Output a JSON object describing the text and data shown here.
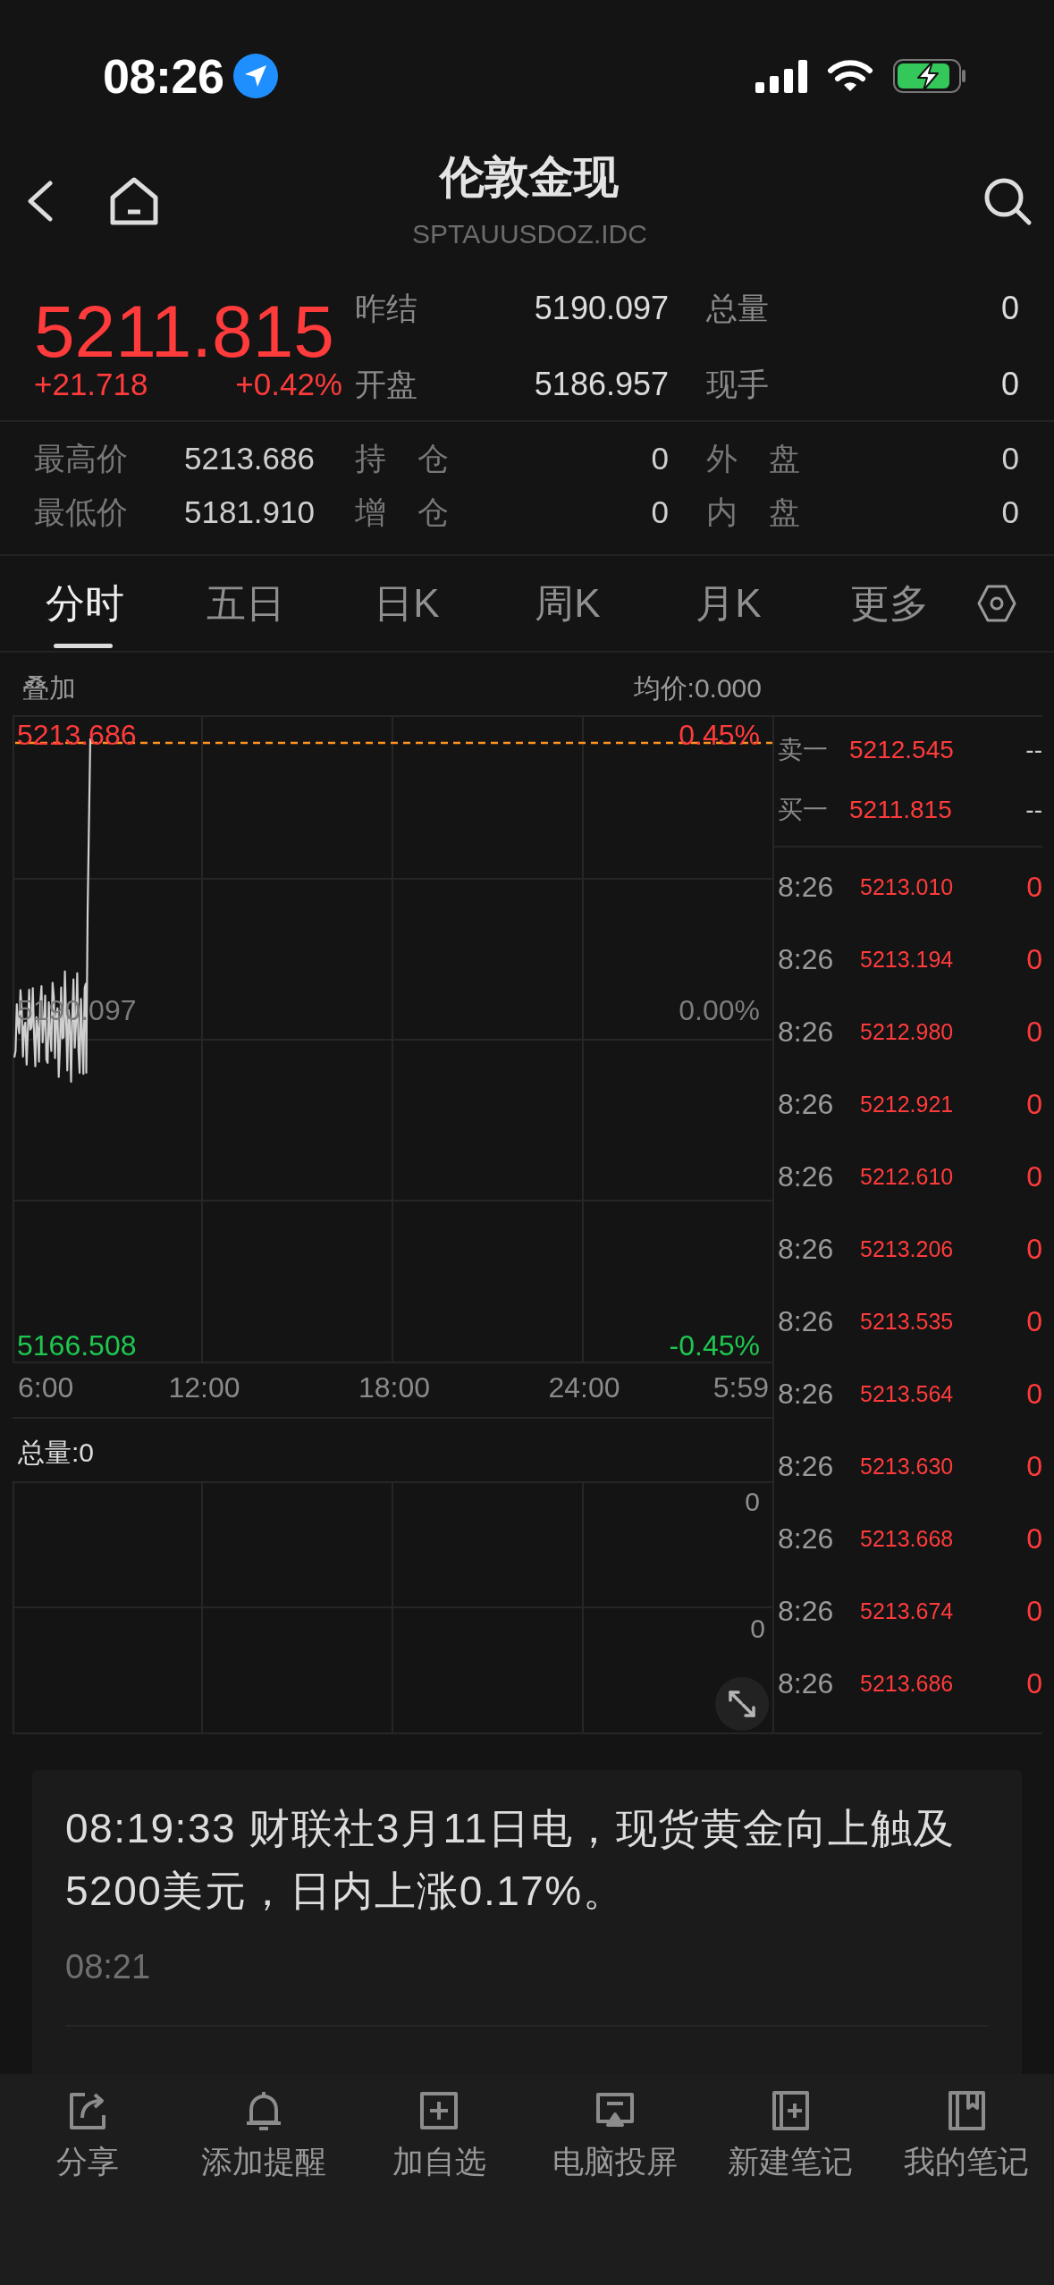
{
  "status_bar": {
    "time": "08:26"
  },
  "header": {
    "title": "伦敦金现",
    "code": "SPTAUUSDOZ.IDC"
  },
  "quote": {
    "price": "5211.815",
    "change": "+21.718",
    "change_pct": "+0.42%",
    "stats": [
      {
        "label": "昨结",
        "value": "5190.097"
      },
      {
        "label": "总量",
        "value": "0"
      },
      {
        "label": "开盘",
        "value": "5186.957"
      },
      {
        "label": "现手",
        "value": "0"
      }
    ]
  },
  "details": [
    {
      "label": "最高价",
      "value": "5213.686"
    },
    {
      "label": "持 仓",
      "value": "0"
    },
    {
      "label": "外 盘",
      "value": "0"
    },
    {
      "label": "最低价",
      "value": "5181.910"
    },
    {
      "label": "增 仓",
      "value": "0"
    },
    {
      "label": "内 盘",
      "value": "0"
    }
  ],
  "tabs": [
    {
      "label": "分时",
      "selected": true
    },
    {
      "label": "五日",
      "selected": false
    },
    {
      "label": "日K",
      "selected": false
    },
    {
      "label": "周K",
      "selected": false
    },
    {
      "label": "月K",
      "selected": false
    },
    {
      "label": "更多",
      "selected": false
    }
  ],
  "chart": {
    "overlay": "叠加",
    "avg_price": "均价:0.000",
    "levels": [
      {
        "price": "5213.686",
        "pct": "0.45%",
        "kind": "up"
      },
      {
        "price": "5190.097",
        "pct": "0.00%",
        "kind": "flat"
      },
      {
        "price": "5166.508",
        "pct": "-0.45%",
        "kind": "down"
      }
    ],
    "times": [
      "6:00",
      "12:00",
      "18:00",
      "24:00",
      "5:59"
    ]
  },
  "volume": {
    "total": "总量:0",
    "labels": [
      "0",
      "0"
    ]
  },
  "order_book": [
    {
      "label": "卖一",
      "price": "5212.545",
      "volume": "--"
    },
    {
      "label": "买一",
      "price": "5211.815",
      "volume": "--"
    }
  ],
  "ticks": [
    {
      "time": "8:26",
      "price": "5213.010",
      "volume": "0"
    },
    {
      "time": "8:26",
      "price": "5213.194",
      "volume": "0"
    },
    {
      "time": "8:26",
      "price": "5212.980",
      "volume": "0"
    },
    {
      "time": "8:26",
      "price": "5212.921",
      "volume": "0"
    },
    {
      "time": "8:26",
      "price": "5212.610",
      "volume": "0"
    },
    {
      "time": "8:26",
      "price": "5213.206",
      "volume": "0"
    },
    {
      "time": "8:26",
      "price": "5213.535",
      "volume": "0"
    },
    {
      "time": "8:26",
      "price": "5213.564",
      "volume": "0"
    },
    {
      "time": "8:26",
      "price": "5213.630",
      "volume": "0"
    },
    {
      "time": "8:26",
      "price": "5213.668",
      "volume": "0"
    },
    {
      "time": "8:26",
      "price": "5213.674",
      "volume": "0"
    },
    {
      "time": "8:26",
      "price": "5213.686",
      "volume": "0"
    }
  ],
  "news": [
    {
      "text": "08:19:33 财联社3月11日电，现货黄金向上触及5200美元，日内上涨0.17%。",
      "time": "08:21"
    }
  ],
  "toolbar": [
    "分享",
    "添加提醒",
    "加自选",
    "电脑投屏",
    "新建笔记",
    "我的笔记"
  ]
}
